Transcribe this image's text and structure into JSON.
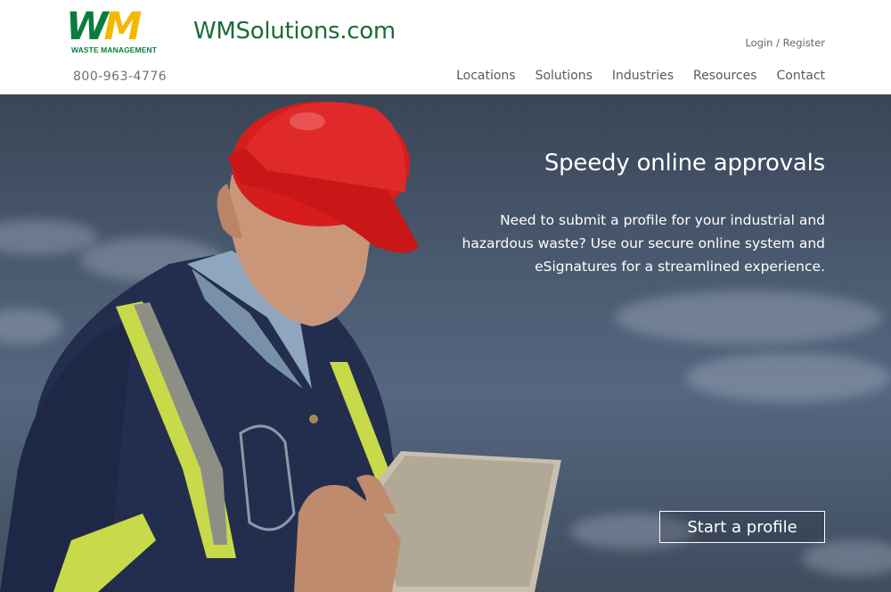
{
  "brand": {
    "logo_letters_w": "W",
    "logo_letters_m": "M",
    "logo_subtitle": "WASTE MANAGEMENT",
    "site_name": "WMSolutions.com",
    "colors": {
      "green": "#0a7d3d",
      "yellow": "#f5b800"
    }
  },
  "header": {
    "login_label": "Login / Register",
    "phone": "800-963-4776",
    "nav": [
      "Locations",
      "Solutions",
      "Industries",
      "Resources",
      "Contact"
    ]
  },
  "hero": {
    "title": "Speedy online approvals",
    "body": "Need to submit a profile for your industrial and hazardous waste? Use our secure online system and eSignatures for a streamlined experience.",
    "cta_label": "Start a profile",
    "image": "worker-in-hardhat-with-tablet-photo"
  }
}
